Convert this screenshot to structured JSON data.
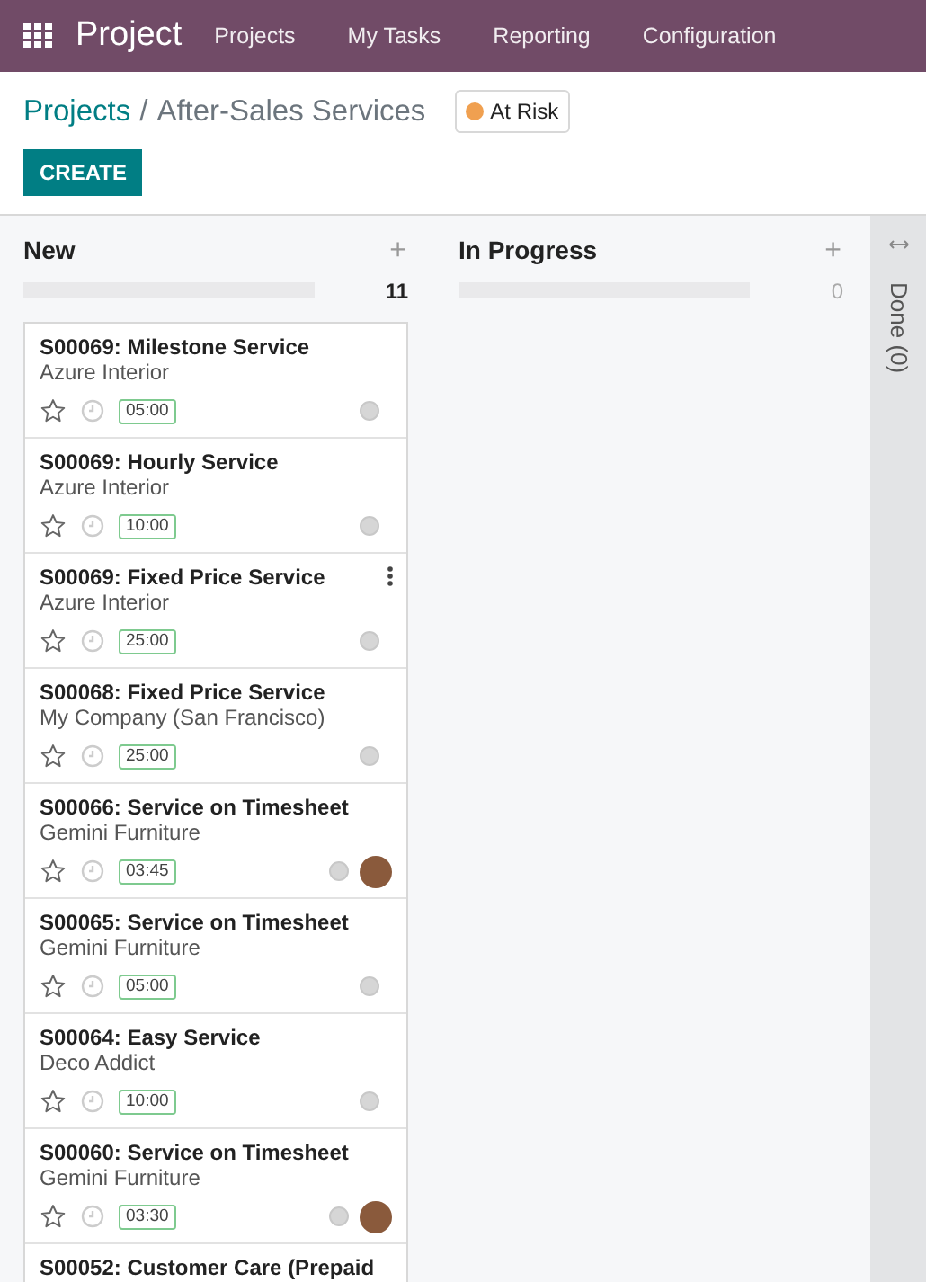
{
  "navbar": {
    "app": "Project",
    "menu": [
      "Projects",
      "My Tasks",
      "Reporting",
      "Configuration"
    ]
  },
  "breadcrumb": {
    "parent": "Projects",
    "separator": "/",
    "current": "After-Sales Services"
  },
  "status_badge": {
    "label": "At Risk",
    "color": "#f0a050"
  },
  "create_button": "CREATE",
  "columns": [
    {
      "title": "New",
      "add": "+",
      "count": "11",
      "level": 0,
      "folded": false,
      "cards": [
        {
          "title": "S00069: Milestone Service",
          "customer": "Azure Interior",
          "hours": "05:00",
          "starred": false,
          "avatar": false,
          "menu_shown": false
        },
        {
          "title": "S00069: Hourly Service",
          "customer": "Azure Interior",
          "hours": "10:00",
          "starred": false,
          "avatar": false,
          "menu_shown": false
        },
        {
          "title": "S00069: Fixed Price Service",
          "customer": "Azure Interior",
          "hours": "25:00",
          "starred": false,
          "avatar": false,
          "menu_shown": true
        },
        {
          "title": "S00068: Fixed Price Service",
          "customer": "My Company (San Francisco)",
          "hours": "25:00",
          "starred": false,
          "avatar": false,
          "menu_shown": false
        },
        {
          "title": "S00066: Service on Timesheet",
          "customer": "Gemini Furniture",
          "hours": "03:45",
          "starred": false,
          "avatar": true,
          "menu_shown": false
        },
        {
          "title": "S00065: Service on Timesheet",
          "customer": "Gemini Furniture",
          "hours": "05:00",
          "starred": false,
          "avatar": false,
          "menu_shown": false
        },
        {
          "title": "S00064: Easy Service",
          "customer": "Deco Addict",
          "hours": "10:00",
          "starred": false,
          "avatar": false,
          "menu_shown": false
        },
        {
          "title": "S00060: Service on Timesheet",
          "customer": "Gemini Furniture",
          "hours": "03:30",
          "starred": false,
          "avatar": true,
          "menu_shown": false
        },
        {
          "title": "S00052: Customer Care (Prepaid"
        }
      ]
    },
    {
      "title": "In Progress",
      "add": "+",
      "count": "0",
      "level": 0,
      "folded": false
    },
    {
      "title": "Done (0)",
      "folded": true
    }
  ]
}
